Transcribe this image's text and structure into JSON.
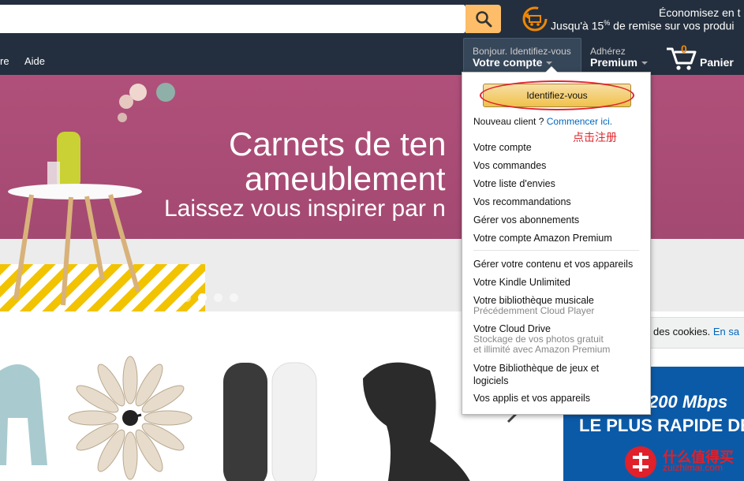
{
  "header": {
    "search": {
      "value": "",
      "placeholder": ""
    },
    "promo": {
      "line1": "Économisez en t",
      "line2_prefix": "Jusqu'à 15",
      "line2_sup": "%",
      "line2_suffix": " de remise sur vos produi"
    },
    "nav": {
      "partial": "re",
      "help": "Aide"
    },
    "account": {
      "line1": "Bonjour. Identifiez-vous",
      "line2": "Votre compte"
    },
    "premium": {
      "line1": "Adhérez",
      "line2": "Premium"
    },
    "cart": {
      "count": "0",
      "label": "Panier"
    }
  },
  "hero": {
    "title_line1": "Carnets de ten",
    "title_line2": "ameublement",
    "subtitle": "Laissez vous inspirer par n",
    "dots": 4,
    "active_dot": 1
  },
  "dropdown": {
    "signin_label": "Identifiez-vous",
    "new_client_text": "Nouveau client ?",
    "new_client_link": "Commencer ici.",
    "annotation": "点击注册",
    "group1": [
      {
        "label": "Votre compte"
      },
      {
        "label": "Vos commandes"
      },
      {
        "label": "Votre liste d'envies"
      },
      {
        "label": "Vos recommandations"
      },
      {
        "label": "Gérer vos abonnements"
      },
      {
        "label": "Votre compte Amazon Premium"
      }
    ],
    "group2": [
      {
        "label": "Gérer votre contenu et vos appareils",
        "sub": ""
      },
      {
        "label": "Votre Kindle Unlimited",
        "sub": ""
      },
      {
        "label": "Votre bibliothèque musicale",
        "sub": "Précédemment Cloud Player"
      },
      {
        "label": "Votre Cloud Drive",
        "sub": "Stockage de vos photos gratuit",
        "sub2": "et illimité avec Amazon Premium"
      },
      {
        "label": "Votre Bibliothèque de jeux et",
        "label2": "logiciels",
        "sub": ""
      },
      {
        "label": "Vos applis et vos appareils",
        "sub": ""
      }
    ]
  },
  "cookie": {
    "text": "des cookies. ",
    "link": "En sa"
  },
  "ad": {
    "line1": "200 Mbps",
    "line2": "LE PLUS RAPIDE DE"
  },
  "watermark": {
    "line1": "什么值得买",
    "line2": "zuizhimai.com"
  },
  "colors": {
    "header_bg": "#232f3e",
    "search_button": "#febd69",
    "cart_count": "#f08804",
    "hero_bg": "#a54a73",
    "link": "#0066c0",
    "annotation": "#e0252b"
  }
}
